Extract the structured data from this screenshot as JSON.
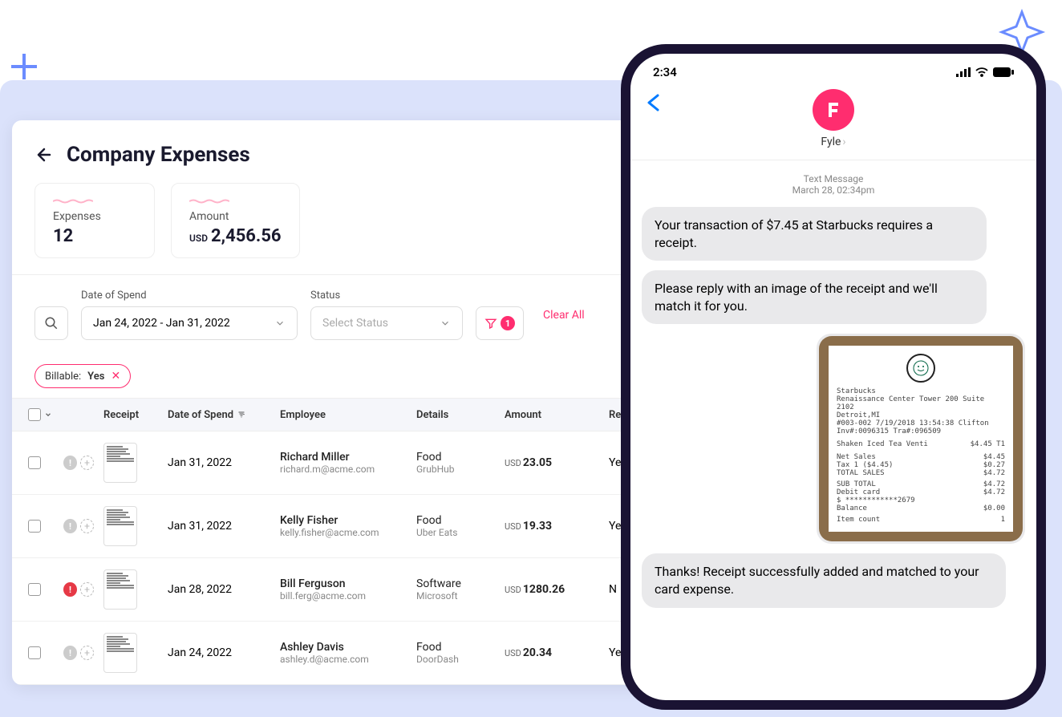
{
  "dashboard": {
    "title": "Company Expenses",
    "stats": {
      "expenses_label": "Expenses",
      "expenses_value": "12",
      "amount_label": "Amount",
      "amount_currency": "USD",
      "amount_value": "2,456.56"
    },
    "filters": {
      "date_label": "Date of Spend",
      "date_value": "Jan 24, 2022 - Jan 31, 2022",
      "status_label": "Status",
      "status_placeholder": "Select Status",
      "filter_badge": "1",
      "clear_label": "Clear All"
    },
    "chip": {
      "label": "Billable:",
      "value": "Yes"
    },
    "columns": {
      "receipt": "Receipt",
      "date": "Date of Spend",
      "employee": "Employee",
      "details": "Details",
      "amount": "Amount",
      "report": "Re"
    },
    "rows": [
      {
        "date": "Jan 31, 2022",
        "name": "Richard Miller",
        "email": "richard.m@acme.com",
        "category": "Food",
        "vendor": "GrubHub",
        "currency": "USD",
        "amount": "23.05",
        "status": "gray",
        "report": "Ye"
      },
      {
        "date": "Jan 31, 2022",
        "name": "Kelly Fisher",
        "email": "kelly.fisher@acme.com",
        "category": "Food",
        "vendor": "Uber Eats",
        "currency": "USD",
        "amount": "19.33",
        "status": "gray",
        "report": "Ye"
      },
      {
        "date": "Jan 28, 2022",
        "name": "Bill Ferguson",
        "email": "bill.ferg@acme.com",
        "category": "Software",
        "vendor": "Microsoft",
        "currency": "USD",
        "amount": "1280.26",
        "status": "red",
        "report": "N"
      },
      {
        "date": "Jan 24, 2022",
        "name": "Ashley Davis",
        "email": "ashley.d@acme.com",
        "category": "Food",
        "vendor": "DoorDash",
        "currency": "USD",
        "amount": "20.34",
        "status": "gray",
        "report": "Ye"
      }
    ]
  },
  "phone": {
    "time": "2:34",
    "contact": "Fyle",
    "meta_type": "Text Message",
    "meta_time": "March 28, 02:34pm",
    "msg1": "Your transaction of $7.45 at Starbucks requires a receipt.",
    "msg2": "Please reply with an image of the receipt and we'll match it for you.",
    "msg3": "Thanks! Receipt successfully added and matched to your card expense.",
    "receipt": {
      "store": "Starbucks",
      "addr1": "Renaissance Center Tower 200 Suite 2102",
      "addr2": "Detroit,MI",
      "addr3": "#003-002 7/19/2018 13:54:38 Clifton",
      "addr4": "Inv#:0096315 Tra#:096509",
      "item": "Shaken Iced Tea Venti",
      "item_price": "$4.45 T1",
      "net_label": "Net Sales",
      "net": "$4.45",
      "tax_label": "Tax 1 ($4.45)",
      "tax": "$0.27",
      "total_sales_label": "TOTAL SALES",
      "total_sales": "$4.72",
      "sub_label": "SUB TOTAL",
      "sub": "$4.72",
      "card_label": "Debit card",
      "card": "$4.72",
      "cardnum": "$ ************2679",
      "balance_label": "Balance",
      "balance": "$0.00",
      "count_label": "Item count",
      "count": "1"
    }
  }
}
